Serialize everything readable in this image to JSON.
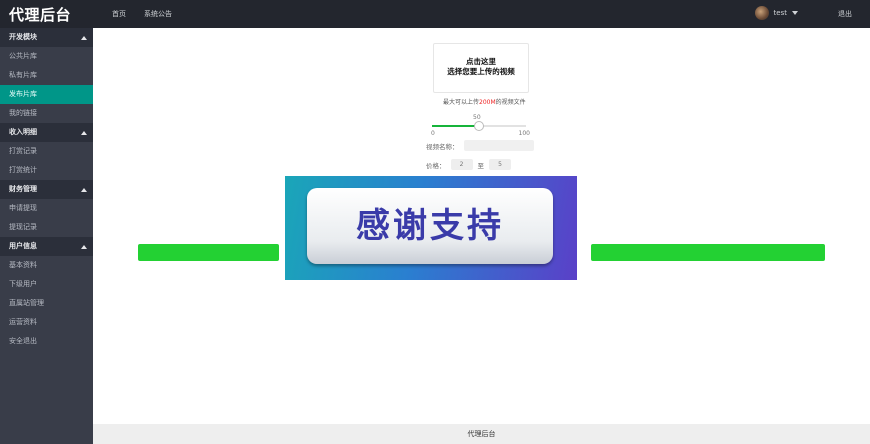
{
  "header": {
    "brand": "代理后台",
    "nav": [
      "首页",
      "系统公告"
    ],
    "user": "test",
    "logout": "退出"
  },
  "sidebar": {
    "groups": [
      {
        "label": "开发模块",
        "items": [
          "公共片库",
          "私有片库",
          "发布片库",
          "我的链接"
        ]
      },
      {
        "label": "收入明细",
        "items": [
          "打赏记录",
          "打赏统计"
        ]
      },
      {
        "label": "财务管理",
        "items": [
          "申请提现",
          "提现记录"
        ]
      },
      {
        "label": "用户信息",
        "items": [
          "基本资料",
          "下级用户",
          "直属站管理",
          "运营资料"
        ]
      }
    ],
    "active_item": "发布片库",
    "last_item": "安全退出"
  },
  "upload": {
    "line1": "点击这里",
    "line2": "选择您要上传的视频",
    "hint_prefix": "最大可以上传",
    "hint_size": "200M",
    "hint_suffix": "的视频文件"
  },
  "slider": {
    "value": "50",
    "min": "0",
    "max": "100",
    "fraction": 0.5
  },
  "form": {
    "name_label": "视频名称：",
    "price_label": "价格：",
    "price_a": "2",
    "price_sep": "至",
    "price_b": "5"
  },
  "banner": {
    "text": "感谢支持"
  },
  "footer": {
    "text": "代理后台"
  },
  "colors": {
    "accent": "#009688",
    "bar": "#23d133",
    "topbar": "#23262e",
    "sidebar": "#393d49"
  }
}
